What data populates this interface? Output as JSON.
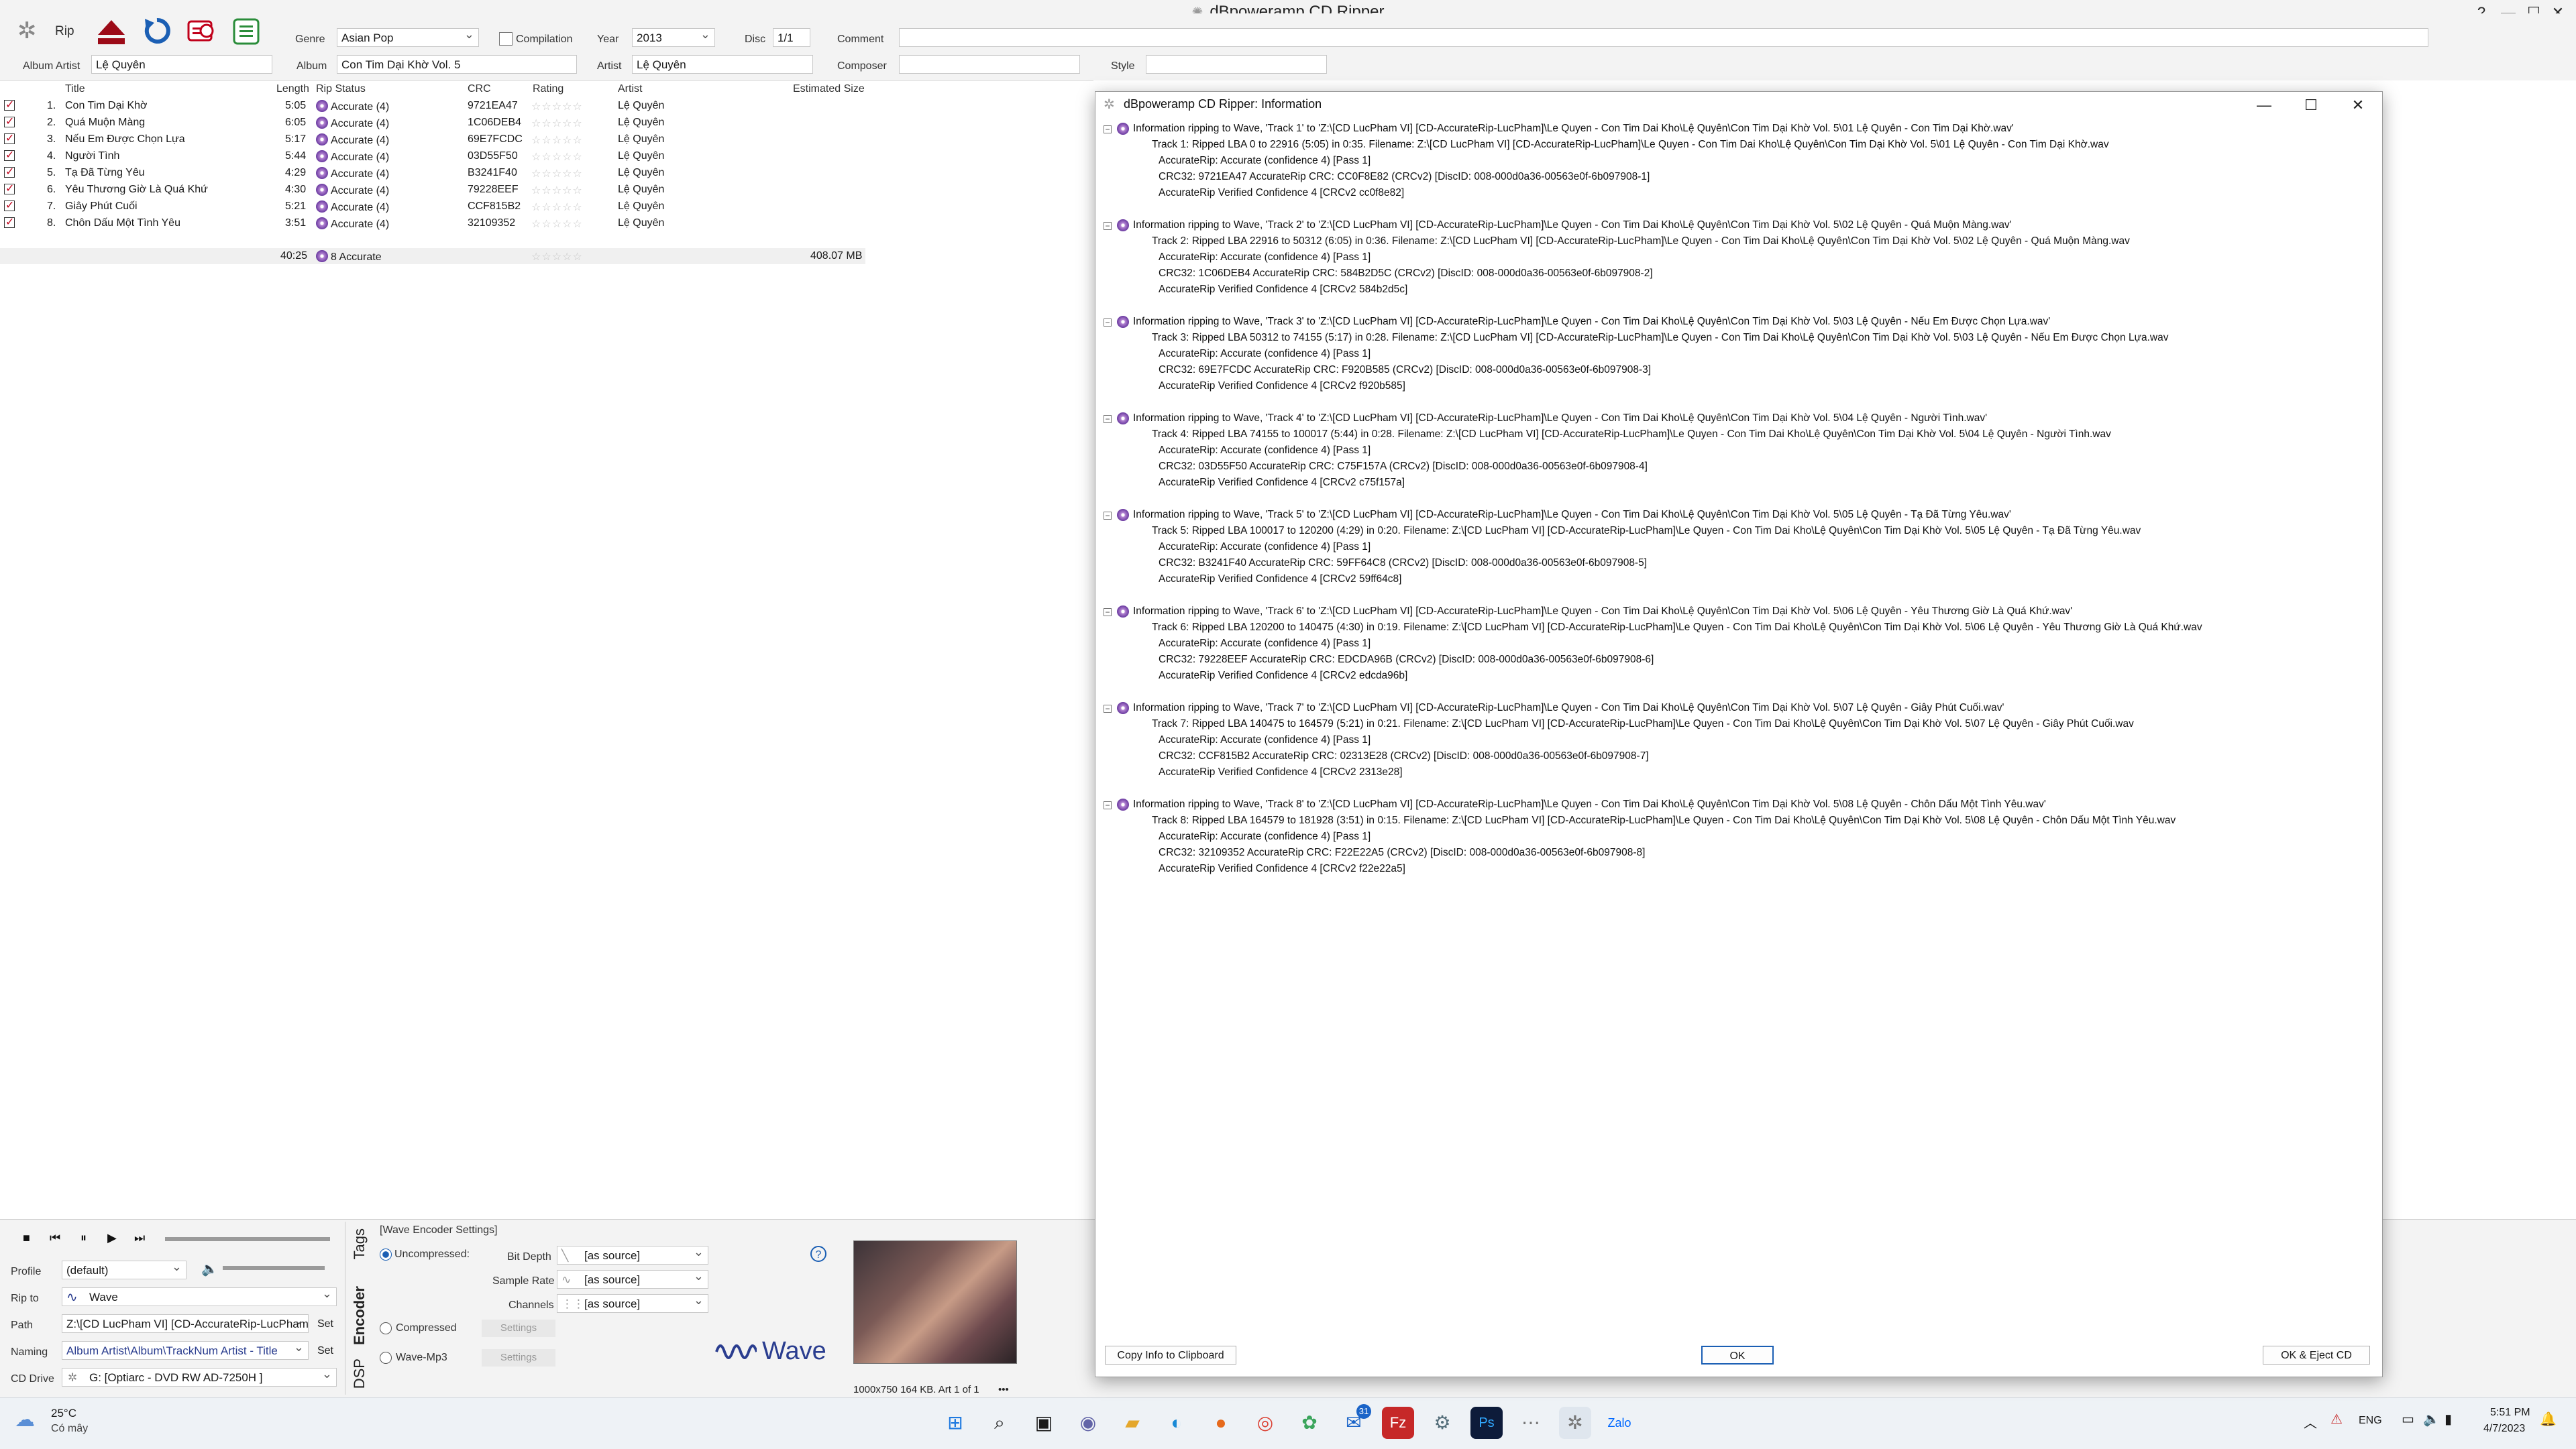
{
  "window": {
    "title": "dBpoweramp CD Ripper",
    "controls": [
      "?",
      "—",
      "☐",
      "✕"
    ]
  },
  "toolbar": {
    "rip_label": "Rip",
    "genre_label": "Genre",
    "genre_value": "Asian Pop",
    "compilation_label": "Compilation",
    "year_label": "Year",
    "year_value": "2013",
    "disc_label": "Disc",
    "disc_value": "1/1",
    "comment_label": "Comment",
    "comment_value": "",
    "album_artist_label": "Album Artist",
    "album_artist_value": "Lệ Quyên",
    "album_label": "Album",
    "album_value": "Con Tim Dại Khờ Vol. 5",
    "artist_label": "Artist",
    "artist_value": "Lệ Quyên",
    "composer_label": "Composer",
    "composer_value": "",
    "style_label": "Style",
    "style_value": ""
  },
  "columns": {
    "title": "Title",
    "length": "Length",
    "rip_status": "Rip Status",
    "crc": "CRC",
    "rating": "Rating",
    "artist": "Artist",
    "size": "Estimated Size"
  },
  "tracks": [
    {
      "num": "1.",
      "title": "Con Tim Dại Khờ",
      "length": "5:05",
      "status": "Accurate (4)",
      "crc": "9721EA47",
      "rating": "☆☆☆☆☆",
      "artist": "Lệ Quyên"
    },
    {
      "num": "2.",
      "title": "Quá Muộn Màng",
      "length": "6:05",
      "status": "Accurate (4)",
      "crc": "1C06DEB4",
      "rating": "☆☆☆☆☆",
      "artist": "Lệ Quyên"
    },
    {
      "num": "3.",
      "title": "Nếu Em Được Chọn Lựa",
      "length": "5:17",
      "status": "Accurate (4)",
      "crc": "69E7FCDC",
      "rating": "☆☆☆☆☆",
      "artist": "Lệ Quyên"
    },
    {
      "num": "4.",
      "title": "Người Tình",
      "length": "5:44",
      "status": "Accurate (4)",
      "crc": "03D55F50",
      "rating": "☆☆☆☆☆",
      "artist": "Lệ Quyên"
    },
    {
      "num": "5.",
      "title": "Tạ Đã Từng Yêu",
      "length": "4:29",
      "status": "Accurate (4)",
      "crc": "B3241F40",
      "rating": "☆☆☆☆☆",
      "artist": "Lệ Quyên"
    },
    {
      "num": "6.",
      "title": "Yêu Thương Giờ Là Quá Khứ",
      "length": "4:30",
      "status": "Accurate (4)",
      "crc": "79228EEF",
      "rating": "☆☆☆☆☆",
      "artist": "Lệ Quyên"
    },
    {
      "num": "7.",
      "title": "Giây Phút Cuối",
      "length": "5:21",
      "status": "Accurate (4)",
      "crc": "CCF815B2",
      "rating": "☆☆☆☆☆",
      "artist": "Lệ Quyên"
    },
    {
      "num": "8.",
      "title": "Chôn Dấu Một Tình Yêu",
      "length": "3:51",
      "status": "Accurate (4)",
      "crc": "32109352",
      "rating": "☆☆☆☆☆",
      "artist": "Lệ Quyên"
    }
  ],
  "totals": {
    "length": "40:25",
    "status": "8 Accurate",
    "rating": "☆☆☆☆☆",
    "size": "408.07 MB"
  },
  "bottom": {
    "profile_label": "Profile",
    "profile_value": "(default)",
    "rip_to_label": "Rip to",
    "rip_to_value": "Wave",
    "path_label": "Path",
    "path_value": "Z:\\[CD LucPham VI] [CD-AccurateRip-LucPham",
    "naming_label": "Naming",
    "naming_value": "Album Artist\\Album\\TrackNum Artist - Title",
    "cd_drive_label": "CD Drive",
    "cd_drive_value": "G:  [Optiarc  - DVD RW AD-7250H ]",
    "set_label": "Set",
    "tabs": [
      "Tags",
      "Encoder",
      "DSP"
    ],
    "encoder_title": "[Wave Encoder Settings]",
    "uncompressed_label": "Uncompressed:",
    "compressed_label": "Compressed",
    "wavemp3_label": "Wave-Mp3",
    "settings_label": "Settings",
    "bit_depth_label": "Bit Depth",
    "bit_depth_value": "[as source]",
    "sample_rate_label": "Sample Rate",
    "sample_rate_value": "[as source]",
    "channels_label": "Channels",
    "channels_value": "[as source]",
    "wave_logo": "Wave",
    "art_info": "1000x750 164 KB. Art 1 of 1",
    "art_more": "•••"
  },
  "dialog": {
    "title": "dBpoweramp CD Ripper: Information",
    "blocks": [
      [
        "Information ripping to Wave, 'Track 1' to 'Z:\\[CD LucPham VI] [CD-AccurateRip-LucPham]\\Le Quyen - Con Tim Dai Kho\\Lệ Quyên\\Con Tim Dại Khờ Vol. 5\\01 Lệ Quyên - Con Tim Dại Khờ.wav'",
        "Track 1:  Ripped LBA 0 to 22916 (5:05) in 0:35. Filename: Z:\\[CD LucPham VI] [CD-AccurateRip-LucPham]\\Le Quyen - Con Tim Dai Kho\\Lệ Quyên\\Con Tim Dại Khờ Vol. 5\\01 Lệ Quyên - Con Tim Dại Khờ.wav",
        "AccurateRip: Accurate (confidence 4)     [Pass 1]",
        "CRC32: 9721EA47     AccurateRip CRC: CC0F8E82 (CRCv2)     [DiscID: 008-000d0a36-00563e0f-6b097908-1]",
        "AccurateRip Verified Confidence 4 [CRCv2 cc0f8e82]"
      ],
      [
        "Information ripping to Wave, 'Track 2' to 'Z:\\[CD LucPham VI] [CD-AccurateRip-LucPham]\\Le Quyen - Con Tim Dai Kho\\Lệ Quyên\\Con Tim Dại Khờ Vol. 5\\02 Lệ Quyên - Quá Muộn Màng.wav'",
        "Track 2:  Ripped LBA 22916 to 50312 (6:05) in 0:36. Filename: Z:\\[CD LucPham VI] [CD-AccurateRip-LucPham]\\Le Quyen - Con Tim Dai Kho\\Lệ Quyên\\Con Tim Dại Khờ Vol. 5\\02 Lệ Quyên - Quá Muộn Màng.wav",
        "AccurateRip: Accurate (confidence 4)     [Pass 1]",
        "CRC32: 1C06DEB4     AccurateRip CRC: 584B2D5C (CRCv2)     [DiscID: 008-000d0a36-00563e0f-6b097908-2]",
        "AccurateRip Verified Confidence 4 [CRCv2 584b2d5c]"
      ],
      [
        "Information ripping to Wave, 'Track 3' to 'Z:\\[CD LucPham VI] [CD-AccurateRip-LucPham]\\Le Quyen - Con Tim Dai Kho\\Lệ Quyên\\Con Tim Dại Khờ Vol. 5\\03 Lệ Quyên - Nếu Em Được Chọn Lựa.wav'",
        "Track 3:  Ripped LBA 50312 to 74155 (5:17) in 0:28. Filename: Z:\\[CD LucPham VI] [CD-AccurateRip-LucPham]\\Le Quyen - Con Tim Dai Kho\\Lệ Quyên\\Con Tim Dại Khờ Vol. 5\\03 Lệ Quyên - Nếu Em Được Chọn Lựa.wav",
        "AccurateRip: Accurate (confidence 4)     [Pass 1]",
        "CRC32: 69E7FCDC     AccurateRip CRC: F920B585 (CRCv2)     [DiscID: 008-000d0a36-00563e0f-6b097908-3]",
        "AccurateRip Verified Confidence 4 [CRCv2 f920b585]"
      ],
      [
        "Information ripping to Wave, 'Track 4' to 'Z:\\[CD LucPham VI] [CD-AccurateRip-LucPham]\\Le Quyen - Con Tim Dai Kho\\Lệ Quyên\\Con Tim Dại Khờ Vol. 5\\04 Lệ Quyên - Người Tình.wav'",
        "Track 4:  Ripped LBA 74155 to 100017 (5:44) in 0:28. Filename: Z:\\[CD LucPham VI] [CD-AccurateRip-LucPham]\\Le Quyen - Con Tim Dai Kho\\Lệ Quyên\\Con Tim Dại Khờ Vol. 5\\04 Lệ Quyên - Người Tình.wav",
        "AccurateRip: Accurate (confidence 4)     [Pass 1]",
        "CRC32: 03D55F50     AccurateRip CRC: C75F157A (CRCv2)     [DiscID: 008-000d0a36-00563e0f-6b097908-4]",
        "AccurateRip Verified Confidence 4 [CRCv2 c75f157a]"
      ],
      [
        "Information ripping to Wave, 'Track 5' to 'Z:\\[CD LucPham VI] [CD-AccurateRip-LucPham]\\Le Quyen - Con Tim Dai Kho\\Lệ Quyên\\Con Tim Dại Khờ Vol. 5\\05 Lệ Quyên - Tạ Đã Từng Yêu.wav'",
        "Track 5:  Ripped LBA 100017 to 120200 (4:29) in 0:20. Filename: Z:\\[CD LucPham VI] [CD-AccurateRip-LucPham]\\Le Quyen - Con Tim Dai Kho\\Lệ Quyên\\Con Tim Dại Khờ Vol. 5\\05 Lệ Quyên - Tạ Đã Từng Yêu.wav",
        "AccurateRip: Accurate (confidence 4)     [Pass 1]",
        "CRC32: B3241F40     AccurateRip CRC: 59FF64C8 (CRCv2)     [DiscID: 008-000d0a36-00563e0f-6b097908-5]",
        "AccurateRip Verified Confidence 4 [CRCv2 59ff64c8]"
      ],
      [
        "Information ripping to Wave, 'Track 6' to 'Z:\\[CD LucPham VI] [CD-AccurateRip-LucPham]\\Le Quyen - Con Tim Dai Kho\\Lệ Quyên\\Con Tim Dại Khờ Vol. 5\\06 Lệ Quyên - Yêu Thương Giờ Là Quá Khứ.wav'",
        "Track 6:  Ripped LBA 120200 to 140475 (4:30) in 0:19. Filename: Z:\\[CD LucPham VI] [CD-AccurateRip-LucPham]\\Le Quyen - Con Tim Dai Kho\\Lệ Quyên\\Con Tim Dại Khờ Vol. 5\\06 Lệ Quyên - Yêu Thương Giờ Là Quá Khứ.wav",
        "AccurateRip: Accurate (confidence 4)     [Pass 1]",
        "CRC32: 79228EEF     AccurateRip CRC: EDCDA96B (CRCv2)     [DiscID: 008-000d0a36-00563e0f-6b097908-6]",
        "AccurateRip Verified Confidence 4 [CRCv2 edcda96b]"
      ],
      [
        "Information ripping to Wave, 'Track 7' to 'Z:\\[CD LucPham VI] [CD-AccurateRip-LucPham]\\Le Quyen - Con Tim Dai Kho\\Lệ Quyên\\Con Tim Dại Khờ Vol. 5\\07 Lệ Quyên - Giây Phút Cuối.wav'",
        "Track 7:  Ripped LBA 140475 to 164579 (5:21) in 0:21. Filename: Z:\\[CD LucPham VI] [CD-AccurateRip-LucPham]\\Le Quyen - Con Tim Dai Kho\\Lệ Quyên\\Con Tim Dại Khờ Vol. 5\\07 Lệ Quyên - Giây Phút Cuối.wav",
        "AccurateRip: Accurate (confidence 4)     [Pass 1]",
        "CRC32: CCF815B2     AccurateRip CRC: 02313E28 (CRCv2)     [DiscID: 008-000d0a36-00563e0f-6b097908-7]",
        "AccurateRip Verified Confidence 4 [CRCv2 2313e28]"
      ],
      [
        "Information ripping to Wave, 'Track 8' to 'Z:\\[CD LucPham VI] [CD-AccurateRip-LucPham]\\Le Quyen - Con Tim Dai Kho\\Lệ Quyên\\Con Tim Dại Khờ Vol. 5\\08 Lệ Quyên - Chôn Dấu Một Tình Yêu.wav'",
        "Track 8:  Ripped LBA 164579 to 181928 (3:51) in 0:15. Filename: Z:\\[CD LucPham VI] [CD-AccurateRip-LucPham]\\Le Quyen - Con Tim Dai Kho\\Lệ Quyên\\Con Tim Dại Khờ Vol. 5\\08 Lệ Quyên - Chôn Dấu Một Tình Yêu.wav",
        "AccurateRip: Accurate (confidence 4)     [Pass 1]",
        "CRC32: 32109352     AccurateRip CRC: F22E22A5 (CRCv2)     [DiscID: 008-000d0a36-00563e0f-6b097908-8]",
        "AccurateRip Verified Confidence 4 [CRCv2 f22e22a5]"
      ]
    ],
    "copy_button": "Copy Info to Clipboard",
    "ok_button": "OK",
    "ok_eject_button": "OK & Eject CD"
  },
  "taskbar": {
    "weather_temp": "25°C",
    "weather_desc": "Có mây",
    "badge_count": "31",
    "language": "ENG",
    "time": "5:51 PM",
    "date": "4/7/2023"
  },
  "colors": {
    "accent_red": "#c0001a",
    "rip_blue": "#1b5fb4",
    "eject_red": "#9c0a17",
    "green": "#2a8c3a",
    "wave_logo": "#2a3d8f"
  }
}
